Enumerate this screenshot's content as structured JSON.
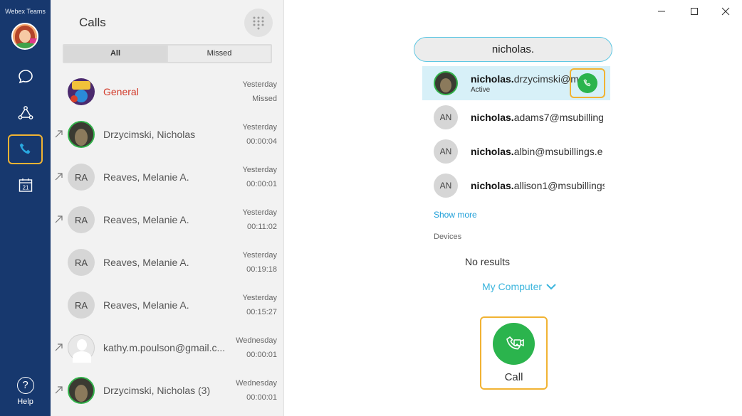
{
  "app": {
    "title": "Webex Teams"
  },
  "rail": {
    "items": [
      {
        "name": "messaging",
        "icon": "chat-bubble-icon"
      },
      {
        "name": "teams",
        "icon": "teams-icon"
      },
      {
        "name": "calls",
        "icon": "phone-icon",
        "active": true
      },
      {
        "name": "meetings",
        "icon": "calendar-icon",
        "text": "21"
      }
    ],
    "help": {
      "icon": "?",
      "label": "Help"
    }
  },
  "calls_panel": {
    "title": "Calls",
    "tabs": [
      {
        "label": "All",
        "active": true
      },
      {
        "label": "Missed",
        "active": false
      }
    ],
    "rows": [
      {
        "name": "General",
        "when": "Yesterday",
        "detail": "Missed",
        "missed": true,
        "avatar": "space",
        "initials": ""
      },
      {
        "name": "Drzycimski, Nicholas",
        "when": "Yesterday",
        "detail": "00:00:04",
        "missed": false,
        "avatar": "photo",
        "initials": ""
      },
      {
        "name": "Reaves, Melanie A.",
        "when": "Yesterday",
        "detail": "00:00:01",
        "missed": false,
        "avatar": "initials",
        "initials": "RA"
      },
      {
        "name": "Reaves, Melanie A.",
        "when": "Yesterday",
        "detail": "00:11:02",
        "missed": false,
        "avatar": "initials",
        "initials": "RA"
      },
      {
        "name": "Reaves, Melanie A.",
        "when": "Yesterday",
        "detail": "00:19:18",
        "missed": false,
        "avatar": "initials",
        "initials": "RA"
      },
      {
        "name": "Reaves, Melanie A.",
        "when": "Yesterday",
        "detail": "00:15:27",
        "missed": false,
        "avatar": "initials",
        "initials": "RA"
      },
      {
        "name": "kathy.m.poulson@gmail.c...",
        "when": "Wednesday",
        "detail": "00:00:01",
        "missed": false,
        "avatar": "ghost",
        "initials": ""
      },
      {
        "name": "Drzycimski, Nicholas (3)",
        "when": "Wednesday",
        "detail": "00:00:01",
        "missed": false,
        "avatar": "photo",
        "initials": ""
      }
    ]
  },
  "dialer": {
    "search_value": "nicholas.",
    "results": [
      {
        "bold": "nicholas.",
        "rest": "drzycimski@m",
        "status": "Active",
        "initials": "",
        "avatar": "photo",
        "selected": true
      },
      {
        "bold": "nicholas.",
        "rest": "adams7@msubilling",
        "status": "",
        "initials": "AN",
        "avatar": "initials",
        "selected": false
      },
      {
        "bold": "nicholas.",
        "rest": "albin@msubillings.e",
        "status": "",
        "initials": "AN",
        "avatar": "initials",
        "selected": false
      },
      {
        "bold": "nicholas.",
        "rest": "allison1@msubillings",
        "status": "",
        "initials": "AN",
        "avatar": "initials",
        "selected": false
      }
    ],
    "show_more": "Show more",
    "devices_label": "Devices",
    "no_results": "No results",
    "device_select": "My Computer",
    "call_label": "Call"
  },
  "colors": {
    "rail": "#17386e",
    "accent": "#1e9ed8",
    "call_green": "#2bb44d",
    "highlight": "#f1b333",
    "missed": "#d23b2b"
  }
}
